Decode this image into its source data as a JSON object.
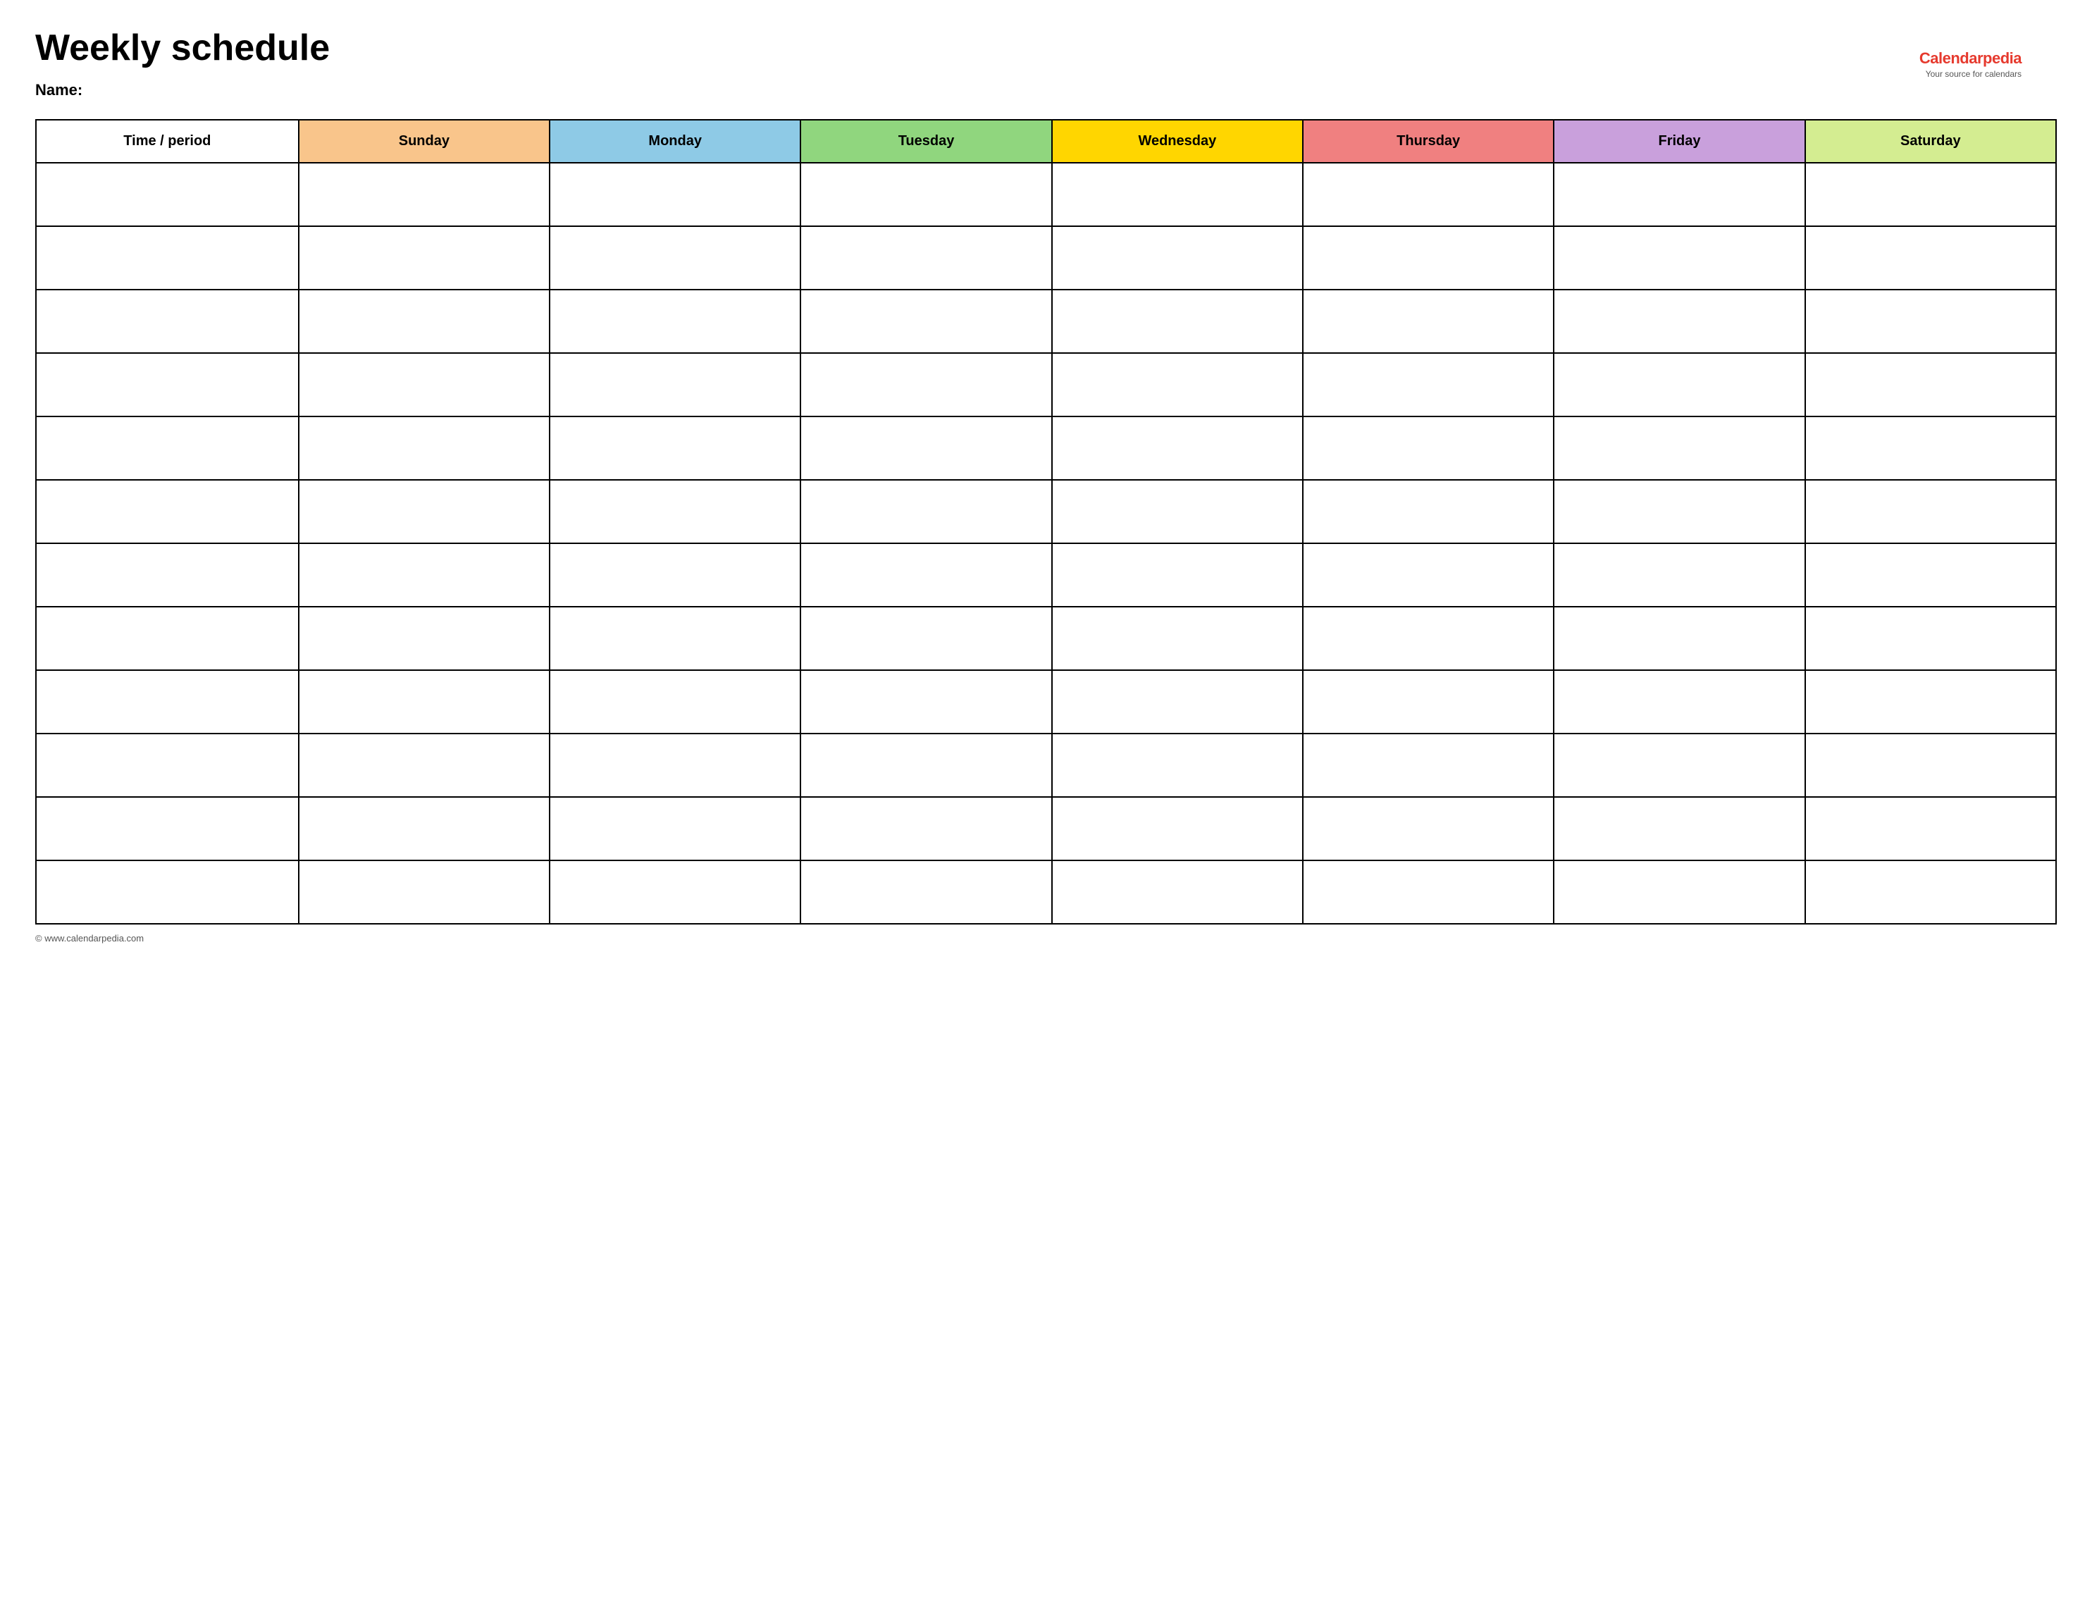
{
  "page": {
    "title": "Weekly schedule",
    "name_label": "Name:",
    "footer_text": "© www.calendarpedia.com"
  },
  "logo": {
    "text_black": "Calendar",
    "text_red": "pedia",
    "tagline": "Your source for calendars"
  },
  "table": {
    "headers": [
      {
        "id": "time",
        "label": "Time / period",
        "color_class": "col-time"
      },
      {
        "id": "sunday",
        "label": "Sunday",
        "color_class": "col-sunday"
      },
      {
        "id": "monday",
        "label": "Monday",
        "color_class": "col-monday"
      },
      {
        "id": "tuesday",
        "label": "Tuesday",
        "color_class": "col-tuesday"
      },
      {
        "id": "wednesday",
        "label": "Wednesday",
        "color_class": "col-wednesday"
      },
      {
        "id": "thursday",
        "label": "Thursday",
        "color_class": "col-thursday"
      },
      {
        "id": "friday",
        "label": "Friday",
        "color_class": "col-friday"
      },
      {
        "id": "saturday",
        "label": "Saturday",
        "color_class": "col-saturday"
      }
    ],
    "row_count": 12
  }
}
